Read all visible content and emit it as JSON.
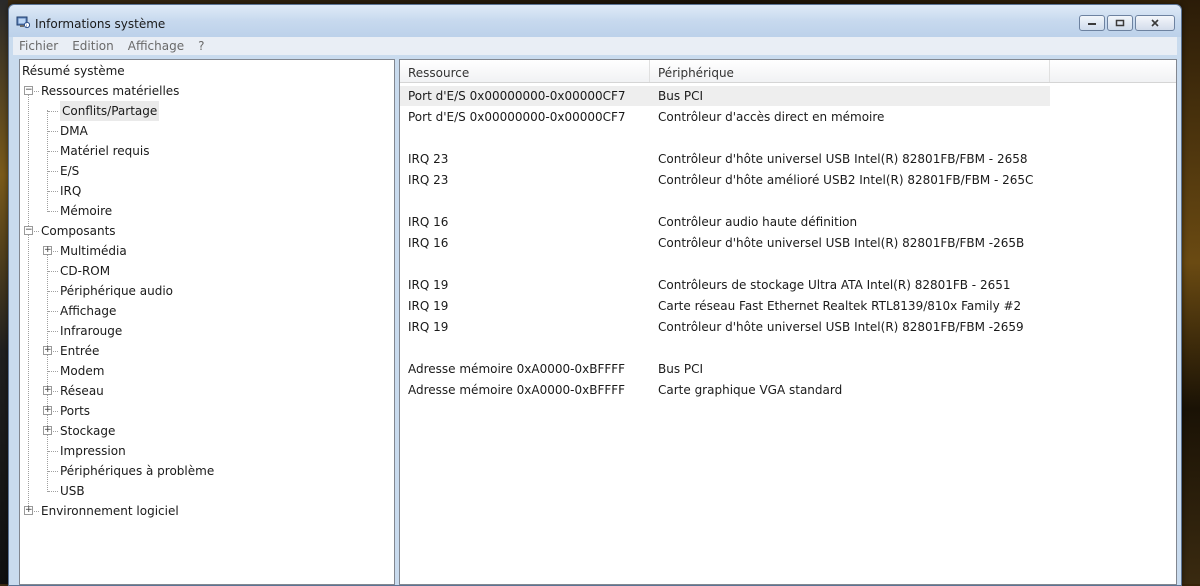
{
  "window": {
    "title": "Informations système"
  },
  "menu": [
    "Fichier",
    "Edition",
    "Affichage",
    "?"
  ],
  "tree": [
    {
      "label": "Résumé système",
      "level": 0,
      "expander": "",
      "selected": false
    },
    {
      "label": "Ressources matérielles",
      "level": 1,
      "expander": "minus",
      "selected": false
    },
    {
      "label": "Conflits/Partage",
      "level": 2,
      "expander": "",
      "selected": true
    },
    {
      "label": "DMA",
      "level": 2,
      "expander": "",
      "selected": false
    },
    {
      "label": "Matériel requis",
      "level": 2,
      "expander": "",
      "selected": false
    },
    {
      "label": "E/S",
      "level": 2,
      "expander": "",
      "selected": false
    },
    {
      "label": "IRQ",
      "level": 2,
      "expander": "",
      "selected": false
    },
    {
      "label": "Mémoire",
      "level": 2,
      "expander": "",
      "selected": false
    },
    {
      "label": "Composants",
      "level": 1,
      "expander": "minus",
      "selected": false
    },
    {
      "label": "Multimédia",
      "level": 2,
      "expander": "plus",
      "selected": false
    },
    {
      "label": "CD-ROM",
      "level": 2,
      "expander": "",
      "selected": false
    },
    {
      "label": "Périphérique audio",
      "level": 2,
      "expander": "",
      "selected": false
    },
    {
      "label": "Affichage",
      "level": 2,
      "expander": "",
      "selected": false
    },
    {
      "label": "Infrarouge",
      "level": 2,
      "expander": "",
      "selected": false
    },
    {
      "label": "Entrée",
      "level": 2,
      "expander": "plus",
      "selected": false
    },
    {
      "label": "Modem",
      "level": 2,
      "expander": "",
      "selected": false
    },
    {
      "label": "Réseau",
      "level": 2,
      "expander": "plus",
      "selected": false
    },
    {
      "label": "Ports",
      "level": 2,
      "expander": "plus",
      "selected": false
    },
    {
      "label": "Stockage",
      "level": 2,
      "expander": "plus",
      "selected": false
    },
    {
      "label": "Impression",
      "level": 2,
      "expander": "",
      "selected": false
    },
    {
      "label": "Périphériques à problème",
      "level": 2,
      "expander": "",
      "selected": false
    },
    {
      "label": "USB",
      "level": 2,
      "expander": "",
      "selected": false
    },
    {
      "label": "Environnement logiciel",
      "level": 1,
      "expander": "plus",
      "selected": false
    }
  ],
  "list": {
    "columns": [
      "Ressource",
      "Périphérique"
    ],
    "rows": [
      {
        "resource": "Port d'E/S 0x00000000-0x00000CF7",
        "device": "Bus PCI",
        "selected": true
      },
      {
        "resource": "Port d'E/S 0x00000000-0x00000CF7",
        "device": "Contrôleur d'accès direct en mémoire",
        "selected": false
      },
      {
        "resource": "",
        "device": "",
        "selected": false
      },
      {
        "resource": "IRQ 23",
        "device": "Contrôleur d'hôte universel USB Intel(R) 82801FB/FBM - 2658",
        "selected": false
      },
      {
        "resource": "IRQ 23",
        "device": "Contrôleur d'hôte amélioré USB2 Intel(R) 82801FB/FBM - 265C",
        "selected": false
      },
      {
        "resource": "",
        "device": "",
        "selected": false
      },
      {
        "resource": "IRQ 16",
        "device": "Contrôleur audio haute définition",
        "selected": false
      },
      {
        "resource": "IRQ 16",
        "device": "Contrôleur d'hôte universel USB Intel(R) 82801FB/FBM -265B",
        "selected": false
      },
      {
        "resource": "",
        "device": "",
        "selected": false
      },
      {
        "resource": "IRQ 19",
        "device": "Contrôleurs de stockage Ultra ATA Intel(R) 82801FB - 2651",
        "selected": false
      },
      {
        "resource": "IRQ 19",
        "device": "Carte réseau Fast Ethernet Realtek RTL8139/810x Family #2",
        "selected": false
      },
      {
        "resource": "IRQ 19",
        "device": "Contrôleur d'hôte universel USB Intel(R) 82801FB/FBM -2659",
        "selected": false
      },
      {
        "resource": "",
        "device": "",
        "selected": false
      },
      {
        "resource": "Adresse mémoire 0xA0000-0xBFFFF",
        "device": "Bus PCI",
        "selected": false
      },
      {
        "resource": "Adresse mémoire 0xA0000-0xBFFFF",
        "device": "Carte graphique VGA standard",
        "selected": false
      }
    ]
  }
}
